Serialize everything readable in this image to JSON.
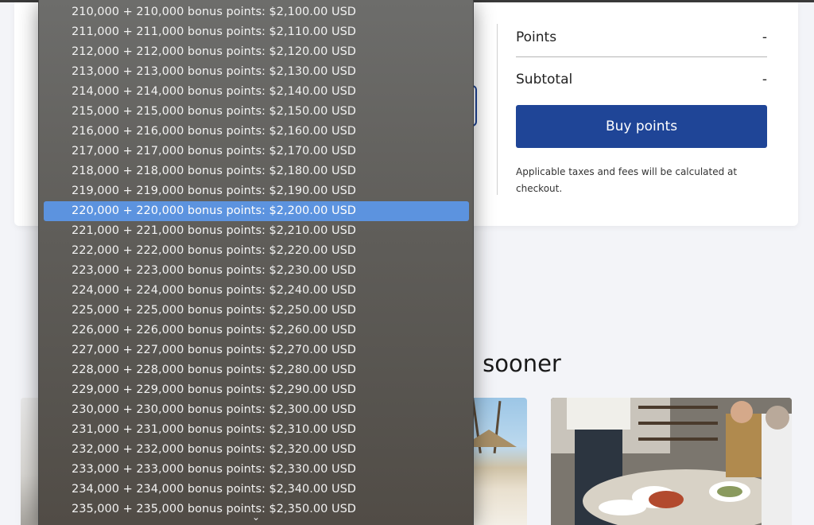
{
  "purchase_summary": {
    "points_label": "Points",
    "points_value": "-",
    "subtotal_label": "Subtotal",
    "subtotal_value": "-",
    "buy_button_label": "Buy points",
    "tax_note": "Applicable taxes and fees will be calculated at checkout."
  },
  "section": {
    "heading_visible_fragment": "el sooner"
  },
  "dropdown": {
    "selected_index": 10,
    "options": [
      "210,000 + 210,000 bonus points: $2,100.00 USD",
      "211,000 + 211,000 bonus points: $2,110.00 USD",
      "212,000 + 212,000 bonus points: $2,120.00 USD",
      "213,000 + 213,000 bonus points: $2,130.00 USD",
      "214,000 + 214,000 bonus points: $2,140.00 USD",
      "215,000 + 215,000 bonus points: $2,150.00 USD",
      "216,000 + 216,000 bonus points: $2,160.00 USD",
      "217,000 + 217,000 bonus points: $2,170.00 USD",
      "218,000 + 218,000 bonus points: $2,180.00 USD",
      "219,000 + 219,000 bonus points: $2,190.00 USD",
      "220,000 + 220,000 bonus points: $2,200.00 USD",
      "221,000 + 221,000 bonus points: $2,210.00 USD",
      "222,000 + 222,000 bonus points: $2,220.00 USD",
      "223,000 + 223,000 bonus points: $2,230.00 USD",
      "224,000 + 224,000 bonus points: $2,240.00 USD",
      "225,000 + 225,000 bonus points: $2,250.00 USD",
      "226,000 + 226,000 bonus points: $2,260.00 USD",
      "227,000 + 227,000 bonus points: $2,270.00 USD",
      "228,000 + 228,000 bonus points: $2,280.00 USD",
      "229,000 + 229,000 bonus points: $2,290.00 USD",
      "230,000 + 230,000 bonus points: $2,300.00 USD",
      "231,000 + 231,000 bonus points: $2,310.00 USD",
      "232,000 + 232,000 bonus points: $2,320.00 USD",
      "233,000 + 233,000 bonus points: $2,330.00 USD",
      "234,000 + 234,000 bonus points: $2,340.00 USD",
      "235,000 + 235,000 bonus points: $2,350.00 USD"
    ],
    "scroll_down_icon": "chevron-down-icon"
  },
  "colors": {
    "brand_blue": "#1f4597",
    "selected_option": "#5c93df"
  }
}
